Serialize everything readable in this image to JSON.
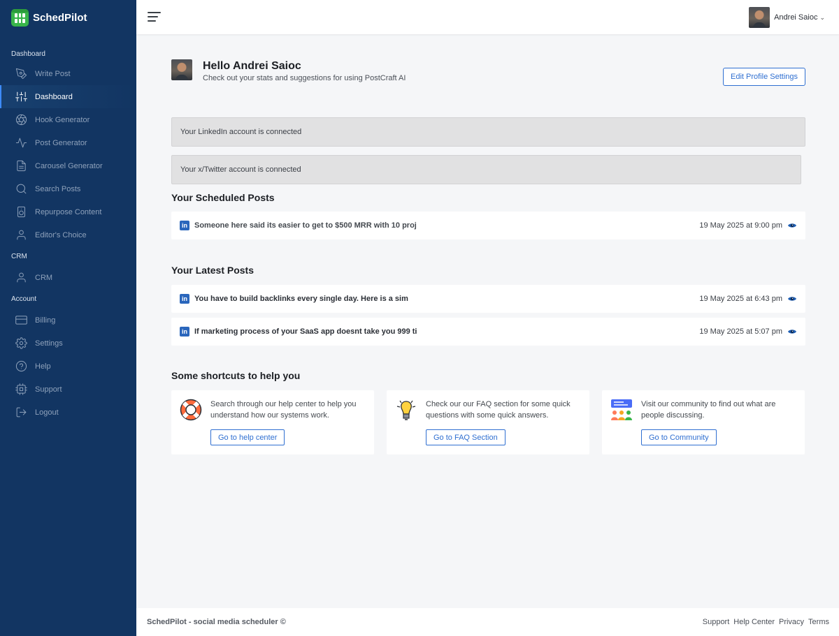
{
  "brand": {
    "name": "SchedPilot",
    "accent": "#39b54a"
  },
  "sidebar": {
    "bg_color": "#123562",
    "sections": [
      {
        "label": "Dashboard"
      },
      {
        "label": "CRM"
      },
      {
        "label": "Account"
      }
    ],
    "items": [
      {
        "label": "Write Post",
        "icon": "pen-icon"
      },
      {
        "label": "Dashboard",
        "icon": "sliders-icon",
        "active": true
      },
      {
        "label": "Hook Generator",
        "icon": "aperture-icon"
      },
      {
        "label": "Post Generator",
        "icon": "activity-icon"
      },
      {
        "label": "Carousel Generator",
        "icon": "document-icon"
      },
      {
        "label": "Search Posts",
        "icon": "search-icon"
      },
      {
        "label": "Repurpose Content",
        "icon": "recycle-icon"
      },
      {
        "label": "Editor's Choice",
        "icon": "user-icon"
      },
      {
        "label": "CRM",
        "icon": "user-icon"
      },
      {
        "label": "Billing",
        "icon": "credit-card-icon"
      },
      {
        "label": "Settings",
        "icon": "gear-icon"
      },
      {
        "label": "Help",
        "icon": "help-icon"
      },
      {
        "label": "Support",
        "icon": "cpu-icon"
      },
      {
        "label": "Logout",
        "icon": "logout-icon"
      }
    ]
  },
  "topbar": {
    "user_name": "Andrei Saioc",
    "caret": "⌄"
  },
  "greeting": {
    "title": "Hello Andrei Saioc",
    "subtitle": "Check out your stats and suggestions for using PostCraft AI",
    "edit_button": "Edit Profile Settings"
  },
  "notices": [
    "Your LinkedIn account is connected",
    "Your x/Twitter account is connected"
  ],
  "scheduled": {
    "heading": "Your Scheduled Posts",
    "posts": [
      {
        "text": "Someone here said its easier to get to $500 MRR with 10 proj",
        "date": "19 May 2025 at 9:00 pm"
      }
    ]
  },
  "latest": {
    "heading": "Your Latest Posts",
    "posts": [
      {
        "text": "You have to build backlinks every single day. Here is a sim",
        "date": "19 May 2025 at 6:43 pm"
      },
      {
        "text": "If marketing process of your SaaS app doesnt take you 999 ti",
        "date": "19 May 2025 at 5:07 pm"
      }
    ]
  },
  "shortcuts": {
    "heading": "Some shortcuts to help you",
    "cards": [
      {
        "text": "Search through our help center to help you understand how our systems work.",
        "button": "Go to help center",
        "icon": "lifebuoy-icon"
      },
      {
        "text": "Check our our FAQ section for some quick questions with some quick answers.",
        "button": "Go to FAQ Section",
        "icon": "lightbulb-icon"
      },
      {
        "text": "Visit our community to find out what are people discussing.",
        "button": "Go to Community",
        "icon": "community-icon"
      }
    ]
  },
  "footer": {
    "left": "SchedPilot - social media scheduler ©",
    "links": [
      "Support",
      "Help Center",
      "Privacy",
      "Terms"
    ]
  }
}
